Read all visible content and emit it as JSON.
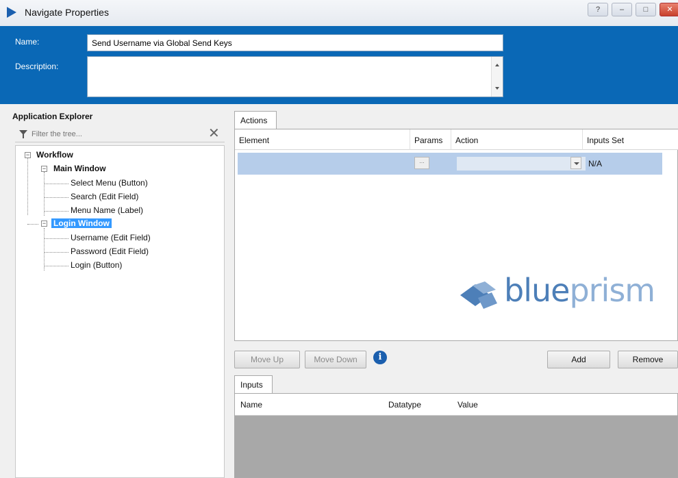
{
  "window": {
    "title": "Navigate Properties",
    "controls": [
      "?",
      "–",
      "□",
      "✕"
    ]
  },
  "header": {
    "name_label": "Name:",
    "name_value": "Send Username via Global Send Keys",
    "description_label": "Description:",
    "description_value": "",
    "background_color": "#0a68b6"
  },
  "explorer": {
    "title": "Application Explorer",
    "filter_placeholder": "Filter the tree...",
    "filter_clear_icon": "✕",
    "tree": {
      "workflow": "Workflow",
      "main_window": "Main Window",
      "main_window_items": [
        "Select Menu (Button)",
        "Search (Edit Field)",
        "Menu Name (Label)"
      ],
      "login_window": "Login Window",
      "login_window_items": [
        "Username (Edit Field)",
        "Password (Edit Field)",
        "Login (Button)"
      ],
      "expander": "−",
      "selected": "Login Window"
    }
  },
  "actions": {
    "tab_label": "Actions",
    "columns": [
      "Element",
      "Params",
      "Action",
      "Inputs Set"
    ],
    "rows": [
      {
        "element": "",
        "params_button": "...",
        "action": "",
        "inputs_set": "N/A"
      }
    ],
    "row_highlight_color": "#b6cdea"
  },
  "logo": {
    "part1": "blue",
    "part2": "prism",
    "colors": [
      "#4d7fb8",
      "#8fb0d6"
    ]
  },
  "buttons": {
    "move_up": "Move Up",
    "move_down": "Move Down",
    "info": "i",
    "add": "Add",
    "remove": "Remove"
  },
  "inputs": {
    "tab_label": "Inputs",
    "columns": [
      "Name",
      "Datatype",
      "Value"
    ]
  }
}
